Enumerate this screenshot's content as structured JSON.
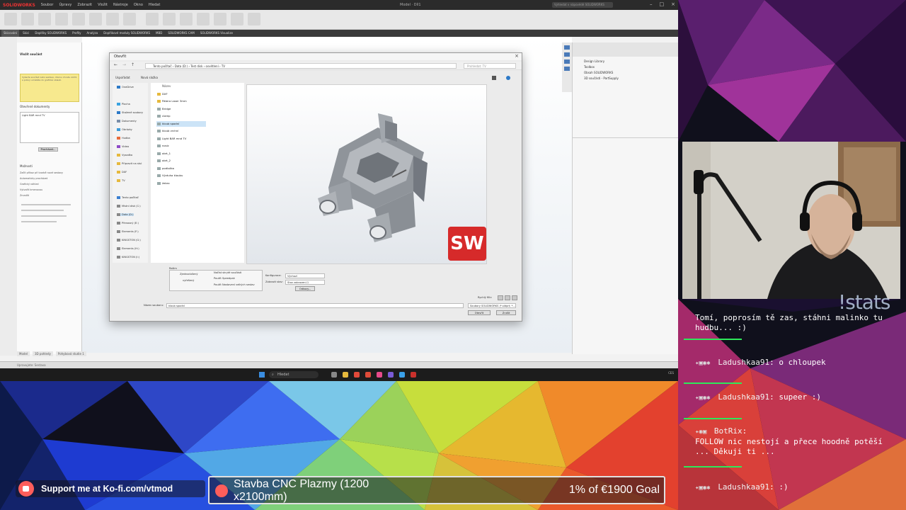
{
  "solidworks": {
    "app_name": "SOLIDWORKS",
    "menu": [
      "Soubor",
      "Úpravy",
      "Zobrazit",
      "Vložit",
      "Nástroje",
      "Okno",
      "Hledat"
    ],
    "window_title": "Model  ·  Díl1",
    "search_placeholder": "Vyhledat v nápovědě SOLIDWORKS",
    "tabs": [
      "Skicování",
      "Skici",
      "Doplňky SOLIDWORKS",
      "Profily",
      "Analýza",
      "Doplňkové moduly SOLIDWORKS",
      "MBD",
      "SOLIDWORKS CAM",
      "SOLIDWORKS Visualize"
    ],
    "left_panel": {
      "title": "Vložit součást",
      "info_text": "Vyberte součást nebo sestavu, kterou chcete vložit, a poté ji umístěte do grafické oblasti.",
      "section_open": "Otevřené dokumenty",
      "list_item": "Light BAR mnd TV",
      "browse_button": "Procházet...",
      "section_options": "Možnosti",
      "options": [
        "Začít příkaz při tvorbě nové sestavy",
        "Automaticky procházet",
        "Grafický náhled",
        "Vytvořit kmenovou",
        "Zrcadlit"
      ]
    },
    "right_panel": {
      "items": [
        "Design Library",
        "Toolbox",
        "Obsah SOLIDWORKS",
        "3D součásti - PartSupply"
      ]
    },
    "bottom_tabs": [
      "Model",
      "3D pohledy",
      "Pohybová studie 1"
    ],
    "status": "Upravujete: Sestava"
  },
  "dialog": {
    "title": "Otevřít",
    "path": "Tento počítač  ›  Data (D:)  ›  Test disk  ›  osvětlení  ›  TV",
    "search_placeholder": "Prohledat: TV",
    "toolbar": {
      "organize": "Uspořádat",
      "new_folder": "Nová složka"
    },
    "nav": [
      "OneDrive",
      "Plocha",
      "Stažené soubory",
      "Dokumenty",
      "Obrázky",
      "Hudba",
      "Videa",
      "Vysaďka",
      "Připravit na stul",
      "DXF",
      "TV",
      "Tento počítač",
      "Místní disk (C:)",
      "Data (D:)",
      "Přenosný (E:)",
      "Elements (F:)",
      "KINGSTON (G:)",
      "Elements (H:)",
      "KINGSTON (I:)"
    ],
    "files_header": "Název",
    "files": [
      "DXF",
      "Pátera Laser 3mm",
      "Bridge",
      "clamp",
      "kloub spodní",
      "kloub vrchní",
      "Light BAR mnd TV",
      "nosic",
      "obrt_1",
      "obrt_2",
      "podložka",
      "Výztuha kloubu",
      "žebro"
    ],
    "selected_file": "kloub spodní",
    "options": {
      "mode_label": "Režim",
      "mode_simplified": "Zjednodušený",
      "mode_resolved": "vyřešený",
      "cb1": "Načíst skryté součásti",
      "cb2": "Použít Speedpak",
      "cb3": "Použít Nastavení velkých sestav",
      "config_label": "Konfigurace:",
      "config_value": "Výchozí",
      "display_label": "Zobrazit stav:",
      "display_value": "Stav zobrazení-1",
      "options_button": "Odkazy..."
    },
    "quick_filter": "Rychlý filtr:",
    "filename_label": "Název souboru:",
    "filename_value": "kloub spodní",
    "filetype_value": "Soubory SOLIDWORKS (*.sldprt; *...",
    "open_button": "Otevřít",
    "cancel_button": "Zrušit",
    "sw_badge": "SW"
  },
  "taskbar": {
    "search_text": "Hledat",
    "tray_text": "CES"
  },
  "overlay": {
    "stats_label": "!stats",
    "kofi_text": "Support me at Ko-fi.com/vtmod",
    "goal_title": "Stavba CNC Plazmy (1200 x2100mm)",
    "goal_progress": "1% of €1900 Goal"
  },
  "chat": [
    {
      "user": "",
      "text": "Tomí, poprosím tě zas, stáhni malinko tu hudbu... :)"
    },
    {
      "user": "Ladushkaa91",
      "text": "o chloupek"
    },
    {
      "user": "Ladushkaa91",
      "text": "supeer :)"
    },
    {
      "user": "BotRix",
      "text": "FOLLOW nic nestojí a přece hoodně potěší ... Děkuji ti ..."
    },
    {
      "user": "Ladushkaa91",
      "text": ":)"
    }
  ],
  "colors": {
    "kofi_red": "#ff5e5b",
    "chat_bar": "#2ee85a",
    "sw_red": "#e33232"
  }
}
